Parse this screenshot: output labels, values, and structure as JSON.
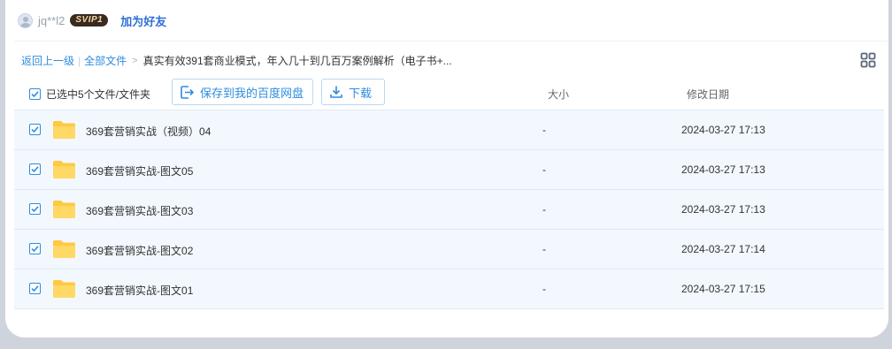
{
  "user": {
    "name": "jq**l2",
    "badge": "SVIP1",
    "add_friend": "加为好友"
  },
  "breadcrumb": {
    "back": "返回上一级",
    "separator": "|",
    "all_files": "全部文件",
    "arrow": ">",
    "current": "真实有效391套商业模式，年入几十到几百万案例解析（电子书+..."
  },
  "toolbar": {
    "selected_text": "已选中5个文件/文件夹",
    "save_label": "保存到我的百度网盘",
    "download_label": "下载",
    "col_size": "大小",
    "col_date": "修改日期"
  },
  "files": [
    {
      "name": "369套营销实战（视频）04",
      "size": "-",
      "date": "2024-03-27 17:13",
      "checked": true
    },
    {
      "name": "369套营销实战-图文05",
      "size": "-",
      "date": "2024-03-27 17:13",
      "checked": true
    },
    {
      "name": "369套营销实战-图文03",
      "size": "-",
      "date": "2024-03-27 17:13",
      "checked": true
    },
    {
      "name": "369套营销实战-图文02",
      "size": "-",
      "date": "2024-03-27 17:14",
      "checked": true
    },
    {
      "name": "369套营销实战-图文01",
      "size": "-",
      "date": "2024-03-27 17:15",
      "checked": true
    }
  ],
  "icons": {
    "avatar": "avatar-icon",
    "grid": "grid-view-icon",
    "save": "save-to-cloud-icon",
    "download": "download-icon",
    "folder": "folder-icon",
    "checkbox": "checkbox-checked-icon"
  },
  "colors": {
    "accent": "#2f8cde",
    "row_bg": "#f2f8fd",
    "folder": "#ffd25c",
    "badge_bg": "#3a2a20",
    "page_bg": "#cfd3dc"
  }
}
